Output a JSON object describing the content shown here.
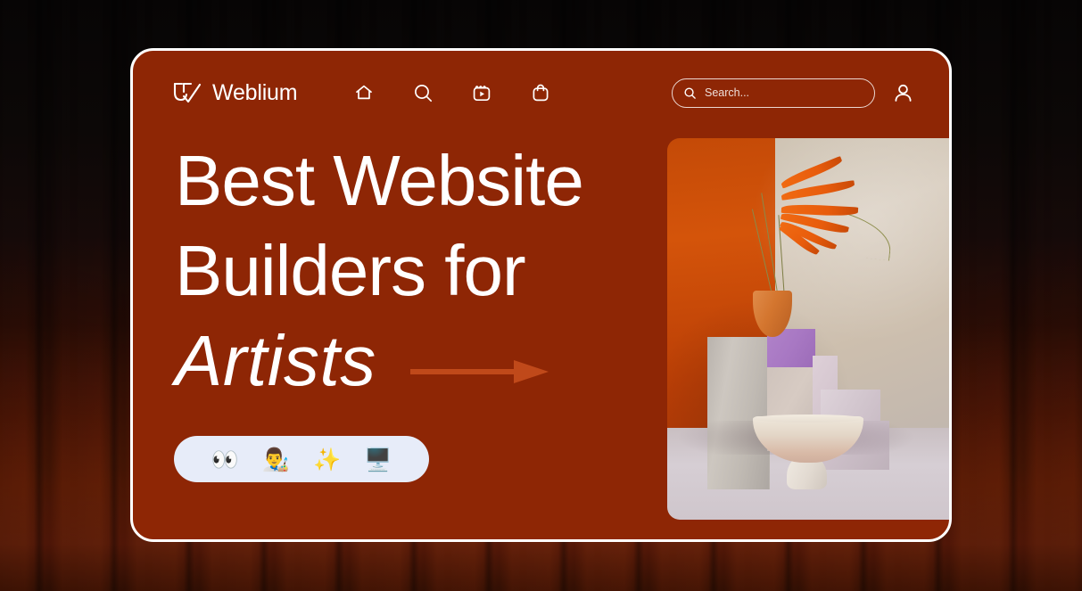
{
  "brand": {
    "name": "Weblium",
    "logo_icon": "weblium-checkmark-logo"
  },
  "nav": {
    "items": [
      {
        "icon": "home-icon",
        "label": "Home"
      },
      {
        "icon": "search-icon",
        "label": "Search"
      },
      {
        "icon": "video-reels-icon",
        "label": "Videos"
      },
      {
        "icon": "shopping-bag-icon",
        "label": "Shop"
      }
    ]
  },
  "search": {
    "placeholder": "Search...",
    "value": "",
    "icon": "search-icon"
  },
  "account": {
    "icon": "user-account-icon",
    "label": "Account"
  },
  "hero": {
    "line1": "Best Website",
    "line2": "Builders for",
    "line3_italic": "Artists",
    "arrow_icon": "right-arrow-icon"
  },
  "emoji_pill": {
    "emojis": [
      {
        "glyph": "👀",
        "name": "eyes-emoji"
      },
      {
        "glyph": "👨‍🎨",
        "name": "artist-emoji"
      },
      {
        "glyph": "✨",
        "name": "sparkles-emoji"
      },
      {
        "glyph": "🖥️",
        "name": "desktop-computer-emoji"
      }
    ]
  },
  "hero_image": {
    "alt": "3D still life with stone blocks, terracotta vase and orange plant"
  },
  "colors": {
    "card_background": "#8e2605",
    "card_border": "#ffffff",
    "arrow": "#c0491a",
    "pill_background": "#e7ecf9",
    "text": "#ffffff"
  }
}
